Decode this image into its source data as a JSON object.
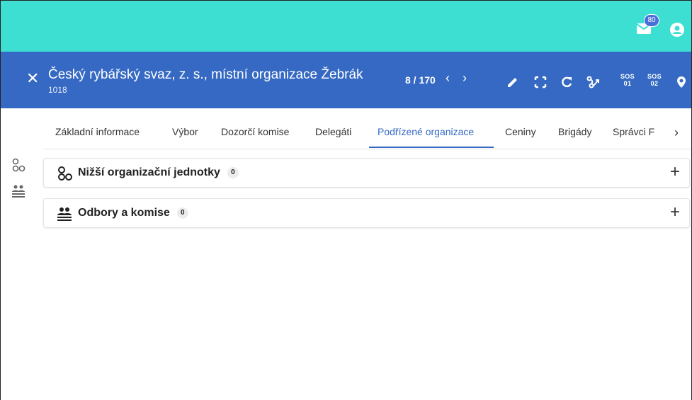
{
  "topbar": {
    "mail_badge": "80",
    "icons": [
      "mail-icon",
      "account-icon"
    ],
    "accent": "#3ddfd3"
  },
  "header": {
    "title": "Český rybářský svaz, z. s., místní organizace Žebrák",
    "subtitle": "1018",
    "pager": "8 / 170",
    "prev_icon": "chevron-left-icon",
    "next_icon": "chevron-right-icon",
    "tools": {
      "sos1_top": "SOS",
      "sos1_bottom": "01",
      "sos2_top": "SOS",
      "sos2_bottom": "02"
    },
    "background": "#3569c3"
  },
  "tabs": [
    {
      "label": "Základní informace"
    },
    {
      "label": "Výbor"
    },
    {
      "label": "Dozorčí komise"
    },
    {
      "label": "Delegáti"
    },
    {
      "label": "Podřízené organizace",
      "active": true
    },
    {
      "label": "Ceniny"
    },
    {
      "label": "Brigády"
    },
    {
      "label": "Správci F"
    }
  ],
  "tabs_next_icon": "chevron-right-icon",
  "panels": [
    {
      "label": "Nižší organizační jednotky",
      "count": "0",
      "icon": "org-units-icon"
    },
    {
      "label": "Odbory a komise",
      "count": "0",
      "icon": "people-icon"
    }
  ]
}
